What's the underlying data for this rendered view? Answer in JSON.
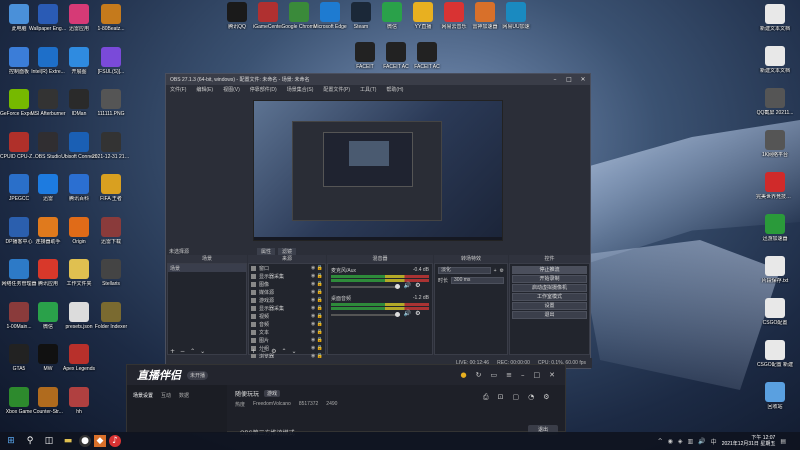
{
  "desktop": {
    "icons_col1": [
      {
        "label": "此电脑",
        "icon": "computer-icon",
        "color": "#4a90d9"
      },
      {
        "label": "控制面板",
        "icon": "control-panel-icon",
        "color": "#3b7dd8"
      },
      {
        "label": "GeForce Experience",
        "icon": "geforce-icon",
        "color": "#76b900"
      },
      {
        "label": "CPUID CPU-Z MSI",
        "icon": "cpuz-icon",
        "color": "#b0302a"
      },
      {
        "label": "JPEGCC",
        "icon": "image-app-icon",
        "color": "#2a6fc9"
      },
      {
        "label": "DP播客中心",
        "icon": "dp-icon",
        "color": "#2b5fae"
      },
      {
        "label": "网络任务管理器",
        "icon": "network-icon",
        "color": "#2d7ac7"
      },
      {
        "label": "1-00Main...",
        "icon": "winrar-icon",
        "color": "#8a3b3b"
      },
      {
        "label": "GTA5",
        "icon": "gta-icon",
        "color": "#222"
      },
      {
        "label": "Xbox Game",
        "icon": "xbox-icon",
        "color": "#2d8a2d"
      }
    ],
    "icons_col2": [
      {
        "label": "Wallpaper Engine:...",
        "icon": "wallpaper-icon",
        "color": "#2a5bb5"
      },
      {
        "label": "Intel(R) Extre...",
        "icon": "intel-icon",
        "color": "#1e6fc9"
      },
      {
        "label": "MSI Afterburner",
        "icon": "afterburner-icon",
        "color": "#333"
      },
      {
        "label": "OBS Studio",
        "icon": "obs-icon",
        "color": "#302e31"
      },
      {
        "label": "迅雷",
        "icon": "thunder-icon",
        "color": "#1d7be0"
      },
      {
        "label": "连接器助手",
        "icon": "helper-icon",
        "color": "#e07a1d"
      },
      {
        "label": "腾讯应用",
        "icon": "tencent-icon",
        "color": "#d8382a"
      },
      {
        "label": "微信",
        "icon": "wechat-icon",
        "color": "#2aa14a"
      },
      {
        "label": "MW",
        "icon": "mw-icon",
        "color": "#111"
      },
      {
        "label": "Counter-Str...",
        "icon": "cs-icon",
        "color": "#b06b1e"
      }
    ],
    "icons_col3": [
      {
        "label": "迅雷应用",
        "icon": "app-icon",
        "color": "#d63a76"
      },
      {
        "label": "开展图",
        "icon": "chat-icon",
        "color": "#2f8be0"
      },
      {
        "label": "IDMan",
        "icon": "idm-icon",
        "color": "#2a2a2a"
      },
      {
        "label": "Ubisoft Connect",
        "icon": "ubisoft-icon",
        "color": "#1a5fb4"
      },
      {
        "label": "腾讯百科",
        "icon": "iu-icon",
        "color": "#2b6fd1"
      },
      {
        "label": "Origin",
        "icon": "origin-icon",
        "color": "#e06b18"
      },
      {
        "label": "工作文件夹",
        "icon": "folder-icon",
        "color": "#e0c050"
      },
      {
        "label": "presets.json",
        "icon": "file-icon",
        "color": "#dcdcdc"
      },
      {
        "label": "Apex Legends",
        "icon": "apex-icon",
        "color": "#b8302b"
      },
      {
        "label": "hh",
        "icon": "game-icon",
        "color": "#b04040"
      }
    ],
    "icons_col4": [
      {
        "label": "1-80Beatz...",
        "icon": "cs-icon",
        "color": "#c57a1c"
      },
      {
        "label": "[FSUL(S)]...",
        "icon": "folder-icon",
        "color": "#7a4ad9"
      },
      {
        "label": "111111.PNG",
        "icon": "image-icon",
        "color": "#555"
      },
      {
        "label": "2021-12-31 21:52:17",
        "icon": "video-icon",
        "color": "#333"
      },
      {
        "label": "FIFA 王者",
        "icon": "game-icon",
        "color": "#d9a020"
      },
      {
        "label": "迅雷下载",
        "icon": "winrar-icon",
        "color": "#8a3b3b"
      },
      {
        "label": "Stellaris",
        "icon": "image-icon",
        "color": "#444"
      },
      {
        "label": "Folder Indexer",
        "icon": "folder-icon",
        "color": "#7a6a30"
      }
    ],
    "icons_top": [
      {
        "label": "腾讯QQ",
        "icon": "qq-icon",
        "color": "#1a1a1a"
      },
      {
        "label": "iGameCenter",
        "icon": "igame-icon",
        "color": "#b03030"
      },
      {
        "label": "Google Chrome",
        "icon": "chrome-icon",
        "color": "#3a8a3a"
      },
      {
        "label": "Microsoft Edge",
        "icon": "edge-icon",
        "color": "#1e7bd1"
      },
      {
        "label": "Steam",
        "icon": "steam-icon",
        "color": "#1b2838"
      },
      {
        "label": "微信",
        "icon": "wechat-icon",
        "color": "#2aa14a"
      },
      {
        "label": "YY直播",
        "icon": "yy-icon",
        "color": "#e8b020"
      },
      {
        "label": "网易云音乐",
        "icon": "music-icon",
        "color": "#d93333"
      },
      {
        "label": "雷神加速器",
        "icon": "booster-icon",
        "color": "#d8702a"
      },
      {
        "label": "网易UU加速",
        "icon": "uu-icon",
        "color": "#1a8ac0"
      }
    ],
    "icons_top2": [
      {
        "label": "FACEIT",
        "icon": "faceit-icon",
        "color": "#222"
      },
      {
        "label": "FACEIT AC",
        "icon": "faceit-icon",
        "color": "#222"
      },
      {
        "label": "FACEIT AC",
        "icon": "faceit-icon",
        "color": "#222"
      }
    ],
    "icons_right": [
      {
        "label": "新建文本文档",
        "icon": "file-icon",
        "color": "#e8e8e8"
      },
      {
        "label": "新建文本文档",
        "icon": "file-icon",
        "color": "#e8e8e8"
      },
      {
        "label": "QQ截屏 20211...",
        "icon": "image-icon",
        "color": "#555"
      },
      {
        "label": "1K网络平台",
        "icon": "image-icon",
        "color": "#555"
      },
      {
        "label": "完美世界竞技平台",
        "icon": "perfect-icon",
        "color": "#d02a2a"
      },
      {
        "label": "迅游加速器",
        "icon": "booster-icon",
        "color": "#2a9a3a"
      },
      {
        "label": "片段保存.txt",
        "icon": "file-icon",
        "color": "#e8e8e8"
      },
      {
        "label": "CSGO配置",
        "icon": "file-icon",
        "color": "#e8e8e8"
      },
      {
        "label": "CSGO配置 新建",
        "icon": "file-icon",
        "color": "#e8e8e8"
      },
      {
        "label": "回收站",
        "icon": "recycle-bin-icon",
        "color": "#5aa0e0"
      }
    ]
  },
  "obs": {
    "title": "OBS 27.1.3 (64-bit, windows) - 配置文件: 未命名 - 场景: 未命名",
    "menu": [
      "文件(F)",
      "编辑(E)",
      "视图(V)",
      "停靠部件(D)",
      "场景集合(S)",
      "配置文件(P)",
      "工具(T)",
      "帮助(H)"
    ],
    "preview_label": "未选择源",
    "props_button": "属性",
    "filters_button": "滤镜",
    "docks": {
      "scenes": {
        "title": "场景",
        "items": [
          "场景"
        ]
      },
      "sources": {
        "title": "来源",
        "items": [
          "窗口",
          "显示器采集",
          "图像",
          "媒体源",
          "游戏源",
          "显示器采集",
          "视频",
          "音频",
          "文本",
          "图片",
          "分组",
          "浏览器"
        ]
      },
      "mixer": {
        "title": "混音器",
        "channels": [
          {
            "name": "麦克风/Aux",
            "db": "-0.4 dB"
          },
          {
            "name": "桌面音频",
            "db": "-1.2 dB"
          }
        ]
      },
      "transitions": {
        "title": "转场特效",
        "type": "淡化",
        "duration_label": "时长",
        "duration": "300 ms"
      },
      "controls": {
        "title": "控件",
        "buttons": [
          "停止推流",
          "开始录制",
          "启动虚拟摄像机",
          "工作室模式",
          "设置",
          "退出"
        ]
      }
    },
    "status": {
      "live": "LIVE: 00:12:46",
      "rec": "REC: 00:00:00",
      "cpu": "CPU: 0.1%, 60.00 fps"
    }
  },
  "live_app": {
    "logo": "直播伴侣",
    "badge": "未开播",
    "tabs": [
      "场景设置",
      "互动",
      "数据"
    ],
    "room_title": "随便玩玩",
    "room_tag": "游戏",
    "sub_info": [
      "热度",
      "FreedomVolcano",
      "8517372",
      "2490"
    ],
    "mode_text": "OBS第三方推流模式",
    "button": "退出"
  },
  "taskbar": {
    "time": "下午 12:07",
    "date": "2021年12月31日 星期五"
  }
}
